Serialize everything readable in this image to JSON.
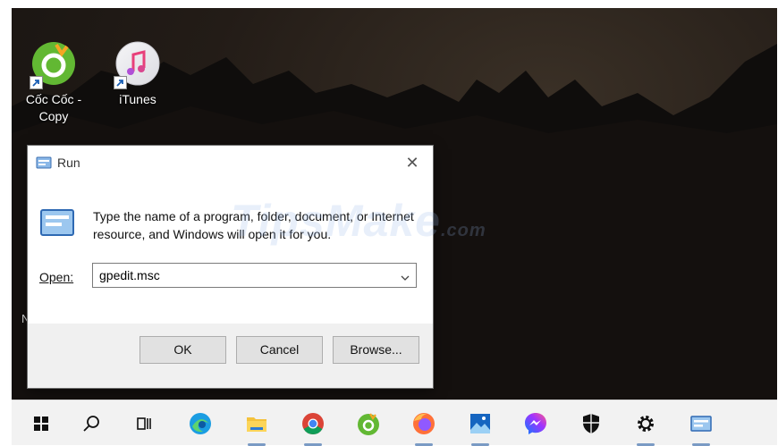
{
  "desktop": {
    "icons": [
      {
        "label": "Cốc Cốc -\nCopy",
        "icon": "coccoc-icon"
      },
      {
        "label": "iTunes",
        "icon": "itunes-icon"
      }
    ],
    "stray_text": "N"
  },
  "run_dialog": {
    "title": "Run",
    "close_glyph": "✕",
    "description": "Type the name of a program, folder, document, or Internet resource, and Windows will open it for you.",
    "open_label": "Open:",
    "open_value": "gpedit.msc",
    "buttons": {
      "ok": "OK",
      "cancel": "Cancel",
      "browse": "Browse..."
    }
  },
  "watermark": {
    "text": "TipsMake",
    "suffix": ".com"
  },
  "taskbar": {
    "items": [
      "start-icon",
      "search-icon",
      "task-view-icon",
      "edge-icon",
      "file-explorer-icon",
      "chrome-icon",
      "coccoc-icon",
      "firefox-icon",
      "photos-icon",
      "messenger-icon",
      "security-icon",
      "settings-icon",
      "run-icon"
    ]
  },
  "colors": {
    "accent": "#0078d7",
    "dialog_footer": "#f0f0f0",
    "taskbar": "#f2f2f2"
  }
}
